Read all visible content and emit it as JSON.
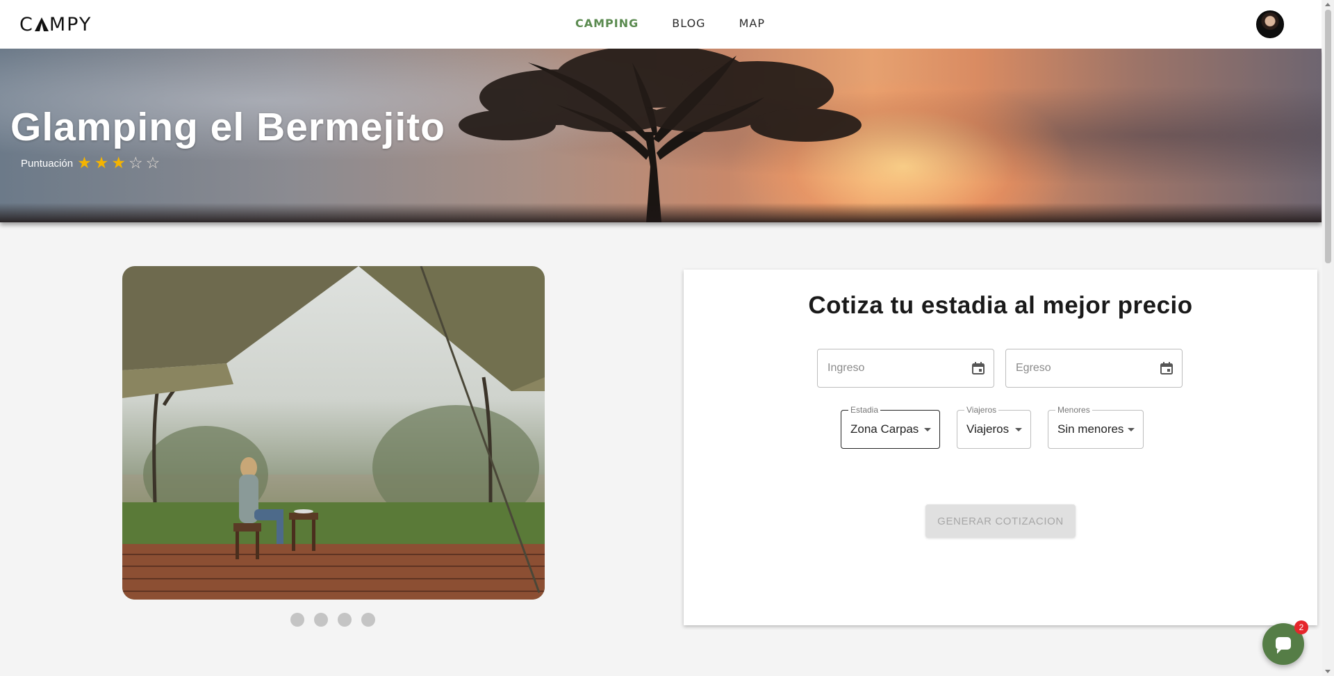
{
  "brand": {
    "logo_text_pre": "C",
    "logo_text_post": "MPY"
  },
  "nav": [
    {
      "label": "CAMPING",
      "active": true
    },
    {
      "label": "BLOG",
      "active": false
    },
    {
      "label": "MAP",
      "active": false
    }
  ],
  "hero": {
    "title": "Glamping el Bermejito",
    "rating_label": "Puntuación",
    "rating": 3,
    "rating_max": 5
  },
  "carousel": {
    "slides": 4,
    "active_index": 0
  },
  "quote": {
    "title": "Cotiza tu estadia al mejor precio",
    "check_in_placeholder": "Ingreso",
    "check_out_placeholder": "Egreso",
    "stay": {
      "label": "Estadia",
      "value": "Zona Carpas"
    },
    "travelers": {
      "label": "Viajeros",
      "value": "Viajeros"
    },
    "minors": {
      "label": "Menores",
      "value": "Sin menores"
    },
    "submit_label": "GENERAR COTIZACION",
    "submit_disabled": true
  },
  "chat": {
    "badge_count": "2"
  },
  "colors": {
    "accent": "#5a8a4f",
    "star": "#f5b400",
    "badge": "#e5262b",
    "chat": "#557d46"
  }
}
